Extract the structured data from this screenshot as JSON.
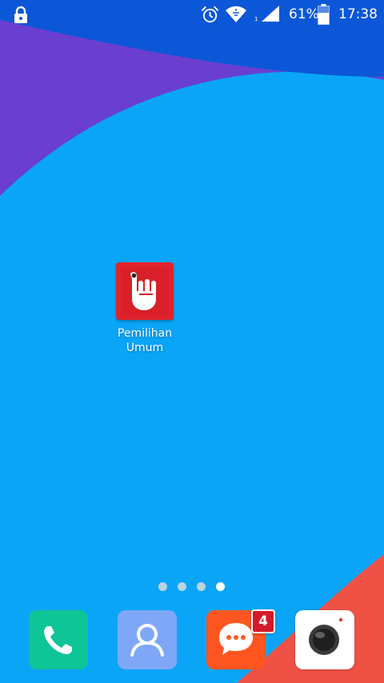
{
  "status_bar": {
    "icons": [
      "lock-icon",
      "alarm-icon",
      "wifi-icon",
      "signal-icon",
      "battery-icon"
    ],
    "battery_text": "61%",
    "time": "17:38"
  },
  "home": {
    "apps": [
      {
        "label": "Pemilihan Umum",
        "icon": "voting-hand-icon",
        "color": "#e0242c"
      }
    ],
    "page_indicator": {
      "pages": 4,
      "current": 4
    }
  },
  "dock": {
    "apps": [
      {
        "name": "phone",
        "icon": "phone-icon",
        "color": "#0ec597"
      },
      {
        "name": "contacts",
        "icon": "contacts-icon",
        "color": "#7fa7f7"
      },
      {
        "name": "messages",
        "icon": "chat-icon",
        "color": "#ff5621",
        "badge": "4"
      },
      {
        "name": "camera",
        "icon": "camera-icon",
        "color": "#ffffff"
      }
    ]
  },
  "wallpaper": {
    "colors": [
      "#0b57d8",
      "#6a3fd0",
      "#0aa5f7",
      "#ef5145"
    ]
  }
}
